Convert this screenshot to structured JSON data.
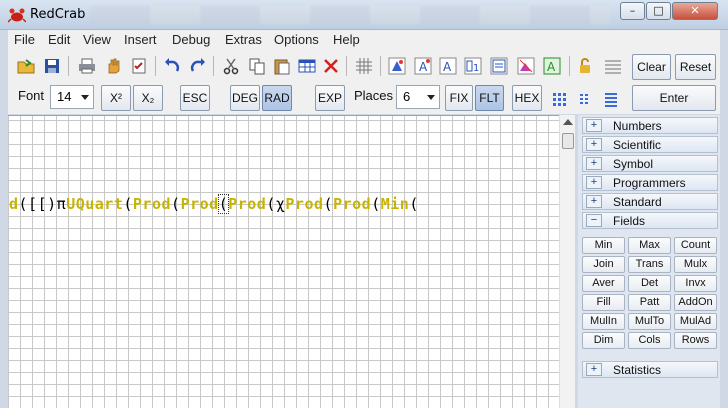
{
  "window": {
    "title": "RedCrab",
    "minimize": "–",
    "maximize": "□",
    "close": "✕"
  },
  "menu": [
    "File",
    "Edit",
    "View",
    "Insert",
    "Debug",
    "Extras",
    "Options",
    "Help"
  ],
  "toolbar": {
    "clear": "Clear",
    "reset": "Reset",
    "enter": "Enter",
    "font_label": "Font",
    "font_size": "14",
    "superscript": "X²",
    "subscript": "X₂",
    "esc": "ESC",
    "deg": "DEG",
    "rad": "RAD",
    "exp": "EXP",
    "places_label": "Places",
    "places_value": "6",
    "fix": "FIX",
    "flt": "FLT",
    "hex": "HEX",
    "active": [
      "RAD",
      "FLT"
    ]
  },
  "expression": {
    "tokens": [
      {
        "t": "d",
        "k": "kw"
      },
      {
        "t": "([[)",
        "k": "pn"
      },
      {
        "t": "π",
        "k": "pn"
      },
      {
        "t": "UQuart",
        "k": "kw"
      },
      {
        "t": "(",
        "k": "pn"
      },
      {
        "t": "Prod",
        "k": "kw"
      },
      {
        "t": "(",
        "k": "pn"
      },
      {
        "t": "Prod",
        "k": "kw"
      },
      {
        "t": "(",
        "k": "cursor"
      },
      {
        "t": "Prod",
        "k": "kw"
      },
      {
        "t": "(χ",
        "k": "pn"
      },
      {
        "t": "Prod",
        "k": "kw"
      },
      {
        "t": "(",
        "k": "pn"
      },
      {
        "t": "Prod",
        "k": "kw"
      },
      {
        "t": "(",
        "k": "pn"
      },
      {
        "t": "Min",
        "k": "kw"
      },
      {
        "t": "(",
        "k": "pn"
      }
    ]
  },
  "sections_top": [
    "Numbers",
    "Scientific",
    "Symbol",
    "Programmers",
    "Standard"
  ],
  "fields_section": {
    "label": "Fields",
    "sign": "−"
  },
  "collapsed_sign": "+",
  "fields": [
    [
      "Min",
      "Max",
      "Count"
    ],
    [
      "Join",
      "Trans",
      "Mulx"
    ],
    [
      "Aver",
      "Det",
      "Invx"
    ],
    [
      "Fill",
      "Patt",
      "AddOn"
    ],
    [
      "MulIn",
      "MulTo",
      "MulAd"
    ],
    [
      "Dim",
      "Cols",
      "Rows"
    ]
  ],
  "statistics_section": "Statistics",
  "colors": {
    "keyword": "#c8b400",
    "accent": "#aec4e4"
  }
}
